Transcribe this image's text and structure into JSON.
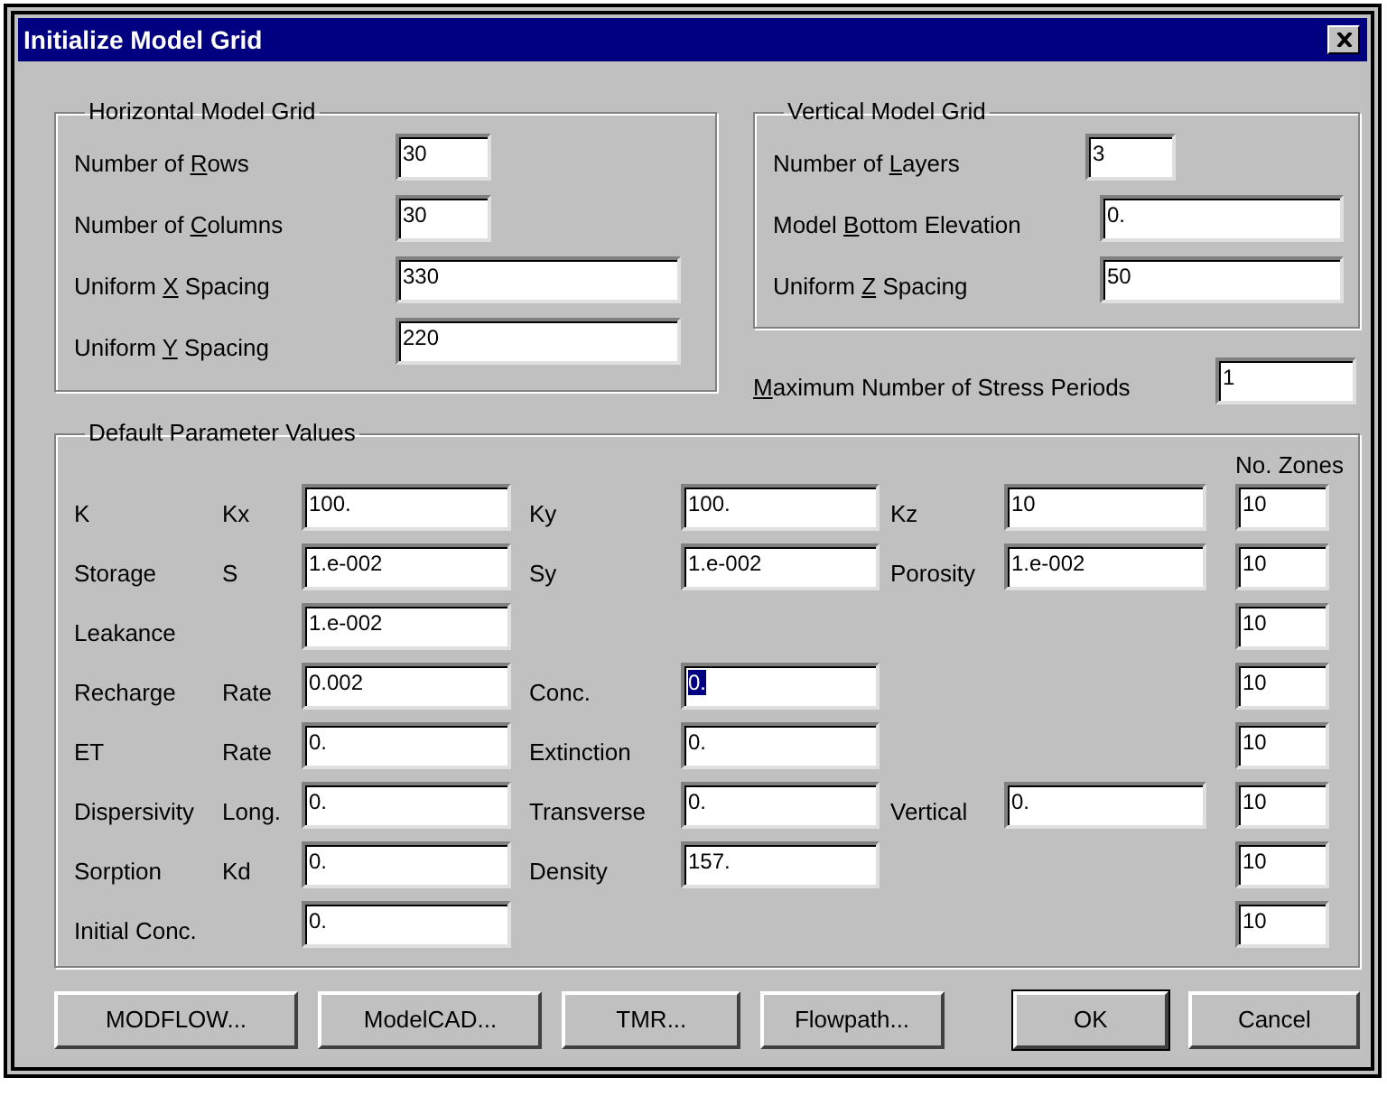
{
  "window": {
    "title": "Initialize Model Grid"
  },
  "horizontal_grid": {
    "title": "Horizontal Model Grid",
    "fields": [
      {
        "label": {
          "text_before": "Number of ",
          "underlined": "R",
          "text_after": "ows"
        },
        "value": "30"
      },
      {
        "label": {
          "text_before": "Number of ",
          "underlined": "C",
          "text_after": "olumns"
        },
        "value": "30"
      },
      {
        "label": {
          "text_before": "Uniform ",
          "underlined": "X",
          "text_after": " Spacing"
        },
        "value": "330"
      },
      {
        "label": {
          "text_before": "Uniform ",
          "underlined": "Y",
          "text_after": " Spacing"
        },
        "value": "220"
      }
    ]
  },
  "vertical_grid": {
    "title": "Vertical Model Grid",
    "fields": [
      {
        "label": {
          "text_before": "Number of ",
          "underlined": "L",
          "text_after": "ayers"
        },
        "value": "3"
      },
      {
        "label": {
          "text_before": "Model ",
          "underlined": "B",
          "text_after": "ottom Elevation"
        },
        "value": "0."
      },
      {
        "label": {
          "text_before": "Uniform ",
          "underlined": "Z",
          "text_after": " Spacing"
        },
        "value": "50"
      }
    ]
  },
  "stress_periods": {
    "label": {
      "underlined": "M",
      "text_after": "aximum Number of Stress Periods"
    },
    "value": "1"
  },
  "parameters": {
    "title": "Default Parameter Values",
    "zones_header": "No. Zones",
    "rows": [
      {
        "label": "K",
        "sublabel": "Kx",
        "fields": [
          {
            "value": "100.",
            "selected": false
          },
          {
            "label": "Ky",
            "value": "100.",
            "selected": false
          },
          {
            "label": "Kz",
            "value": "10",
            "selected": false
          }
        ],
        "zones": "10"
      },
      {
        "label": "Storage",
        "sublabel": "S",
        "fields": [
          {
            "value": "1.e-002",
            "selected": false
          },
          {
            "label": "Sy",
            "value": "1.e-002",
            "selected": false
          },
          {
            "label": "Porosity",
            "value": "1.e-002",
            "selected": false
          }
        ],
        "zones": "10"
      },
      {
        "label": "Leakance",
        "fields": [
          {
            "value": "1.e-002",
            "selected": false
          }
        ],
        "zones": "10"
      },
      {
        "label": "Recharge",
        "sublabel": "Rate",
        "fields": [
          {
            "value": "0.002",
            "selected": false
          },
          {
            "label": "Conc.",
            "value": "0.",
            "selected": true
          }
        ],
        "zones": "10"
      },
      {
        "label": "ET",
        "sublabel": "Rate",
        "fields": [
          {
            "value": "0.",
            "selected": false
          },
          {
            "label": "Extinction",
            "value": "0.",
            "selected": false
          }
        ],
        "zones": "10"
      },
      {
        "label": "Dispersivity",
        "sublabel": "Long.",
        "fields": [
          {
            "value": "0.",
            "selected": false
          },
          {
            "label": "Transverse",
            "value": "0.",
            "selected": false
          },
          {
            "label": "Vertical",
            "value": "0.",
            "selected": false
          }
        ],
        "zones": "10"
      },
      {
        "label": "Sorption",
        "sublabel": "Kd",
        "fields": [
          {
            "value": "0.",
            "selected": false
          },
          {
            "label": "Density",
            "value": "157.",
            "selected": false
          }
        ],
        "zones": "10"
      },
      {
        "label": "Initial Conc.",
        "fields": [
          {
            "value": "0.",
            "selected": false
          }
        ],
        "zones": "10"
      }
    ]
  },
  "buttons": [
    {
      "label": "MODFLOW...",
      "default": false
    },
    {
      "label": "ModelCAD...",
      "default": false
    },
    {
      "label": "TMR...",
      "default": false
    },
    {
      "label": "Flowpath...",
      "default": false
    },
    {
      "label": "OK",
      "default": true
    },
    {
      "label": "Cancel",
      "default": false
    }
  ]
}
